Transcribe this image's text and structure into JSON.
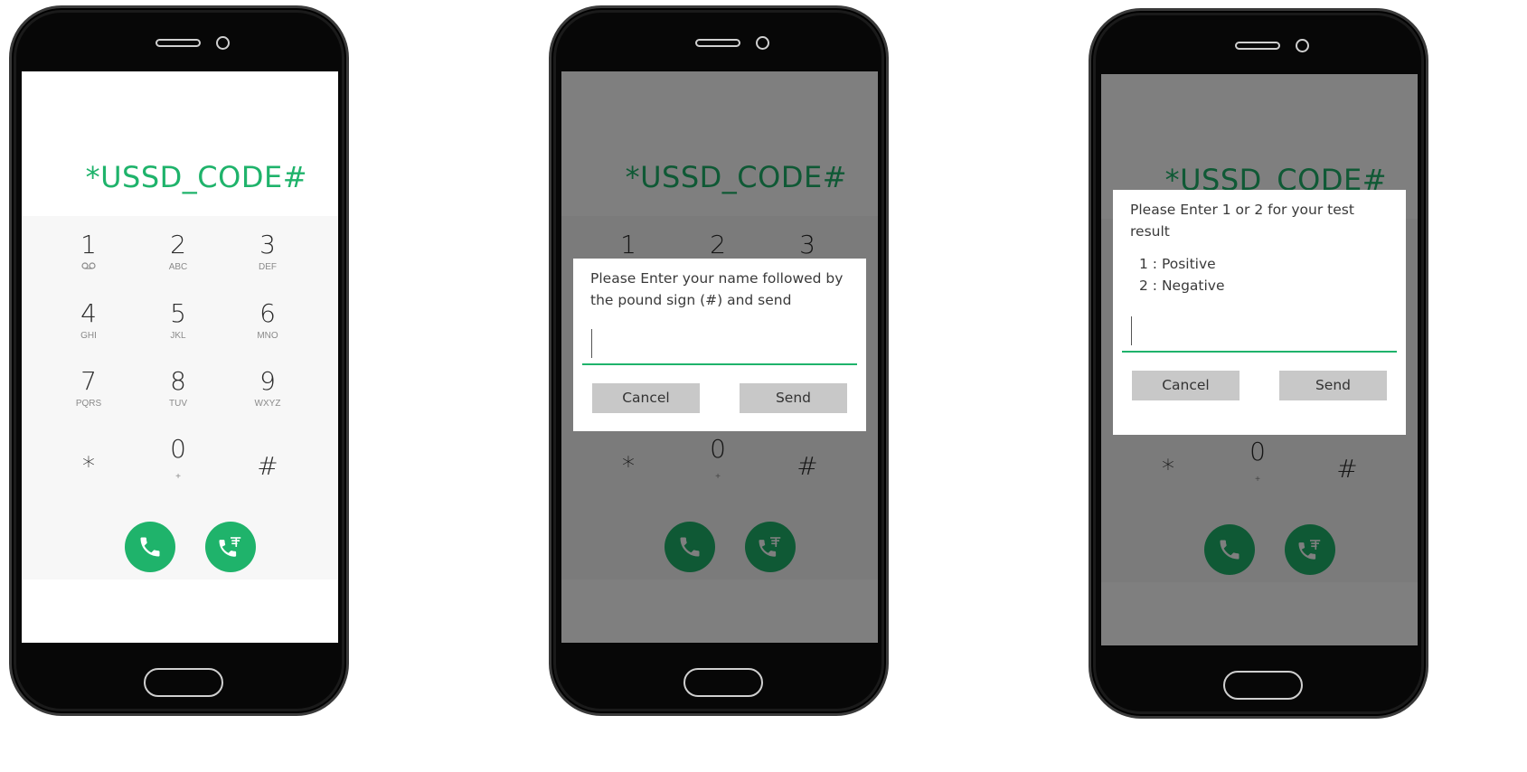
{
  "ussd_code": "*USSD_CODE#",
  "accent_color": "#1fb36b",
  "keypad": [
    {
      "digit": "1",
      "letters": "voicemail-icon"
    },
    {
      "digit": "2",
      "letters": "ABC"
    },
    {
      "digit": "3",
      "letters": "DEF"
    },
    {
      "digit": "4",
      "letters": "GHI"
    },
    {
      "digit": "5",
      "letters": "JKL"
    },
    {
      "digit": "6",
      "letters": "MNO"
    },
    {
      "digit": "7",
      "letters": "PQRS"
    },
    {
      "digit": "8",
      "letters": "TUV"
    },
    {
      "digit": "9",
      "letters": "WXYZ"
    },
    {
      "digit": "*",
      "letters": ""
    },
    {
      "digit": "0",
      "letters": "+"
    },
    {
      "digit": "#",
      "letters": ""
    }
  ],
  "phones": [
    {
      "screen": "dialer"
    },
    {
      "screen": "name-dialog",
      "dialog": {
        "message": "Please Enter your name followed by the pound sign (#) and send",
        "input_value": "",
        "cancel_label": "Cancel",
        "send_label": "Send"
      }
    },
    {
      "screen": "test-result-dialog",
      "dialog": {
        "message": "Please Enter 1 or 2 for your test result",
        "options": [
          "1 : Positive",
          "2 : Negative"
        ],
        "input_value": "",
        "cancel_label": "Cancel",
        "send_label": "Send"
      }
    }
  ],
  "icons": {
    "call": "phone-call-icon",
    "video_call": "message-call-icon"
  }
}
